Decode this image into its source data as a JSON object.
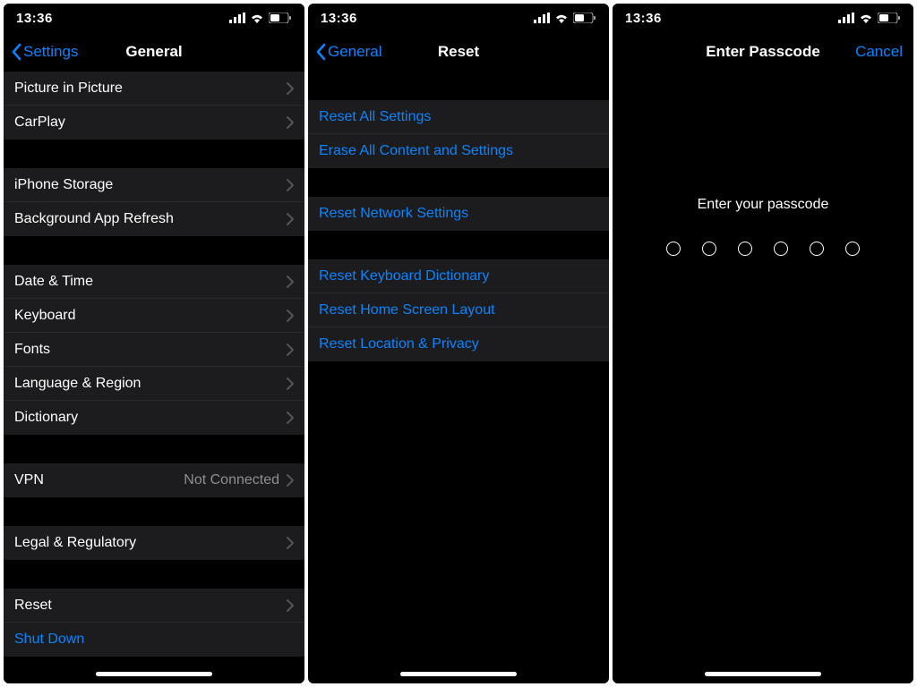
{
  "status": {
    "time": "13:36"
  },
  "colors": {
    "accent": "#0a84ff"
  },
  "screen1": {
    "nav": {
      "back": "Settings",
      "title": "General"
    },
    "groups": [
      {
        "type": "rows",
        "rows": [
          {
            "label": "Picture in Picture",
            "chevron": true
          },
          {
            "label": "CarPlay",
            "chevron": true
          }
        ]
      },
      {
        "type": "gap"
      },
      {
        "type": "rows",
        "rows": [
          {
            "label": "iPhone Storage",
            "chevron": true
          },
          {
            "label": "Background App Refresh",
            "chevron": true
          }
        ]
      },
      {
        "type": "gap"
      },
      {
        "type": "rows",
        "rows": [
          {
            "label": "Date & Time",
            "chevron": true
          },
          {
            "label": "Keyboard",
            "chevron": true
          },
          {
            "label": "Fonts",
            "chevron": true
          },
          {
            "label": "Language & Region",
            "chevron": true
          },
          {
            "label": "Dictionary",
            "chevron": true
          }
        ]
      },
      {
        "type": "gap"
      },
      {
        "type": "rows",
        "rows": [
          {
            "label": "VPN",
            "detail": "Not Connected",
            "chevron": true
          }
        ]
      },
      {
        "type": "gap"
      },
      {
        "type": "rows",
        "rows": [
          {
            "label": "Legal & Regulatory",
            "chevron": true
          }
        ]
      },
      {
        "type": "gap"
      },
      {
        "type": "rows",
        "rows": [
          {
            "label": "Reset",
            "chevron": true
          },
          {
            "label": "Shut Down",
            "link": true
          }
        ]
      }
    ]
  },
  "screen2": {
    "nav": {
      "back": "General",
      "title": "Reset"
    },
    "groups": [
      {
        "type": "gap"
      },
      {
        "type": "rows",
        "style": "reset",
        "rows": [
          {
            "label": "Reset All Settings"
          },
          {
            "label": "Erase All Content and Settings"
          }
        ]
      },
      {
        "type": "gap"
      },
      {
        "type": "rows",
        "style": "reset",
        "rows": [
          {
            "label": "Reset Network Settings"
          }
        ]
      },
      {
        "type": "gap"
      },
      {
        "type": "rows",
        "style": "reset",
        "rows": [
          {
            "label": "Reset Keyboard Dictionary"
          },
          {
            "label": "Reset Home Screen Layout"
          },
          {
            "label": "Reset Location & Privacy"
          }
        ]
      }
    ]
  },
  "screen3": {
    "nav": {
      "title": "Enter Passcode",
      "right": "Cancel"
    },
    "prompt": "Enter your passcode",
    "dot_count": 6
  }
}
